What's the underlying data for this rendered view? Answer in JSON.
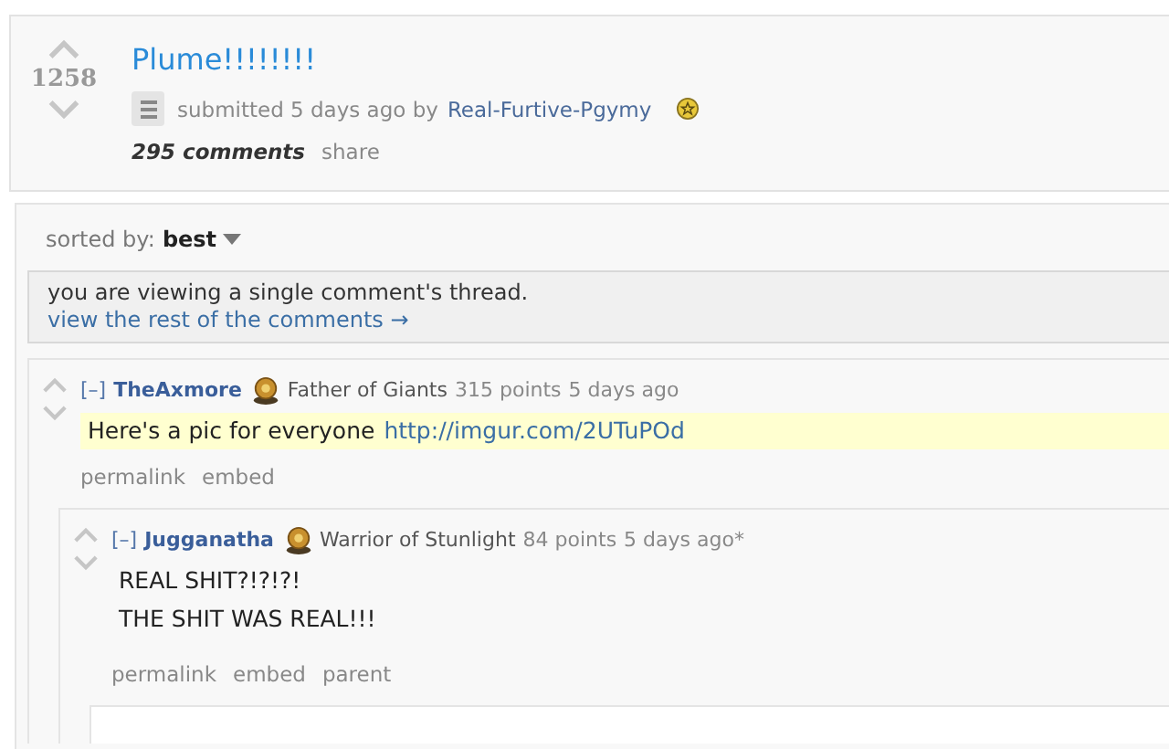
{
  "post": {
    "score": "1258",
    "title": "Plume!!!!!!!!",
    "tagline_prefix": "submitted 5 days ago by",
    "author": "Real-Furtive-Pgymy",
    "comments_link": "295 comments",
    "share": "share"
  },
  "sort": {
    "label": "sorted by:",
    "value": "best"
  },
  "thread_notice": {
    "message": "you are viewing a single comment's thread.",
    "link": "view the rest of the comments →"
  },
  "comments": [
    {
      "toggle": "[–]",
      "author": "TheAxmore",
      "flair": "Father of Giants",
      "points": "315 points",
      "time": "5 days ago",
      "highlighted": true,
      "body": [
        {
          "text": "Here's a pic for everyone",
          "link": "http://imgur.com/2UTuPOd"
        }
      ],
      "buttons": [
        "permalink",
        "embed"
      ],
      "children": [
        {
          "toggle": "[–]",
          "author": "Jugganatha",
          "flair": "Warrior of Stunlight",
          "points": "84 points",
          "time": "5 days ago*",
          "highlighted": false,
          "body": [
            {
              "text": "REAL SHIT?!?!?!"
            },
            {
              "text": "THE SHIT WAS REAL!!!"
            }
          ],
          "buttons": [
            "permalink",
            "embed",
            "parent"
          ],
          "has_more": true
        }
      ]
    }
  ]
}
